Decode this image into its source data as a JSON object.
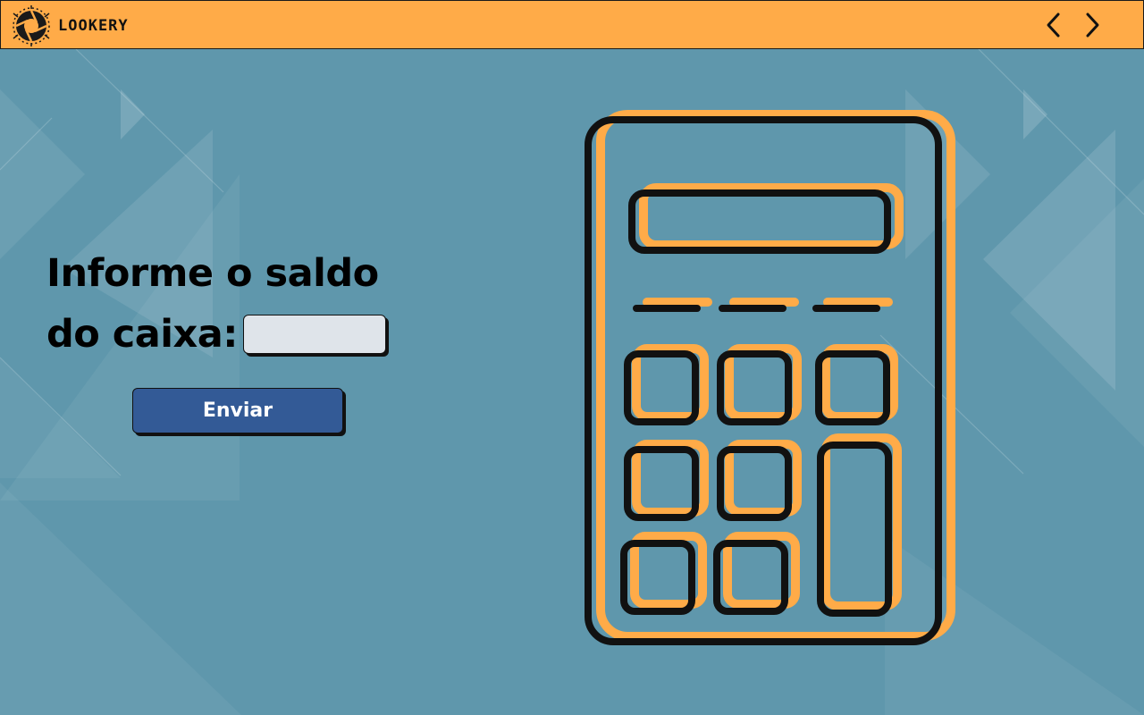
{
  "app": {
    "brand_name": "LOOKERY"
  },
  "nav": {
    "prev_icon": "chevron-left-icon",
    "next_icon": "chevron-right-icon"
  },
  "form": {
    "prompt_line1": "Informe o saldo",
    "prompt_line2": "do caixa:",
    "balance_value": "",
    "submit_label": "Enviar"
  },
  "illustration": {
    "icon": "calculator-icon"
  },
  "colors": {
    "topbar": "#ffab48",
    "background": "#5f97ac",
    "accent": "#ffab48",
    "button": "#335a96",
    "input": "#dfe4ea",
    "outline": "#111111"
  }
}
